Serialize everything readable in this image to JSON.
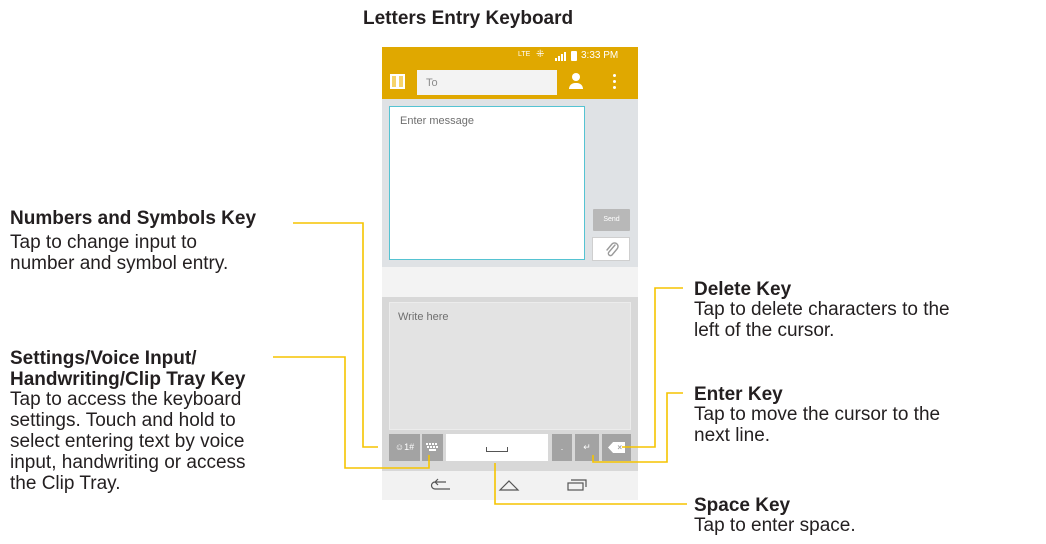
{
  "title": "Letters Entry Keyboard",
  "phone": {
    "status_bar": {
      "network": "LTE",
      "time": "3:33 PM"
    },
    "app_bar": {
      "to_placeholder": "To"
    },
    "compose": {
      "message_placeholder": "Enter message",
      "send_label": "Send"
    },
    "keyboard": {
      "write_placeholder": "Write here",
      "numsym_label": "☺1#",
      "period_label": ".",
      "enter_label": "↵",
      "delete_label": "×"
    }
  },
  "callouts": {
    "numsym": {
      "title": "Numbers and Symbols Key",
      "body": [
        "Tap to change input to",
        "number and symbol entry."
      ]
    },
    "settings": {
      "title_lines": [
        "Settings/Voice Input/",
        "Handwriting/Clip Tray Key"
      ],
      "body": [
        "Tap to access the keyboard",
        "settings. Touch and hold to",
        "select entering text by voice",
        "input, handwriting or access",
        "the Clip Tray."
      ]
    },
    "delete": {
      "title": "Delete Key",
      "body": [
        "Tap to delete characters to the",
        "left of the cursor."
      ]
    },
    "enter": {
      "title": "Enter Key",
      "body": [
        "Tap to move the cursor to the",
        "next line."
      ]
    },
    "space": {
      "title": "Space Key",
      "body": [
        "Tap to enter space."
      ]
    }
  },
  "colors": {
    "accent": "#e0a800",
    "callout_line": "#f5c400",
    "focus_border": "#55c3d2"
  }
}
